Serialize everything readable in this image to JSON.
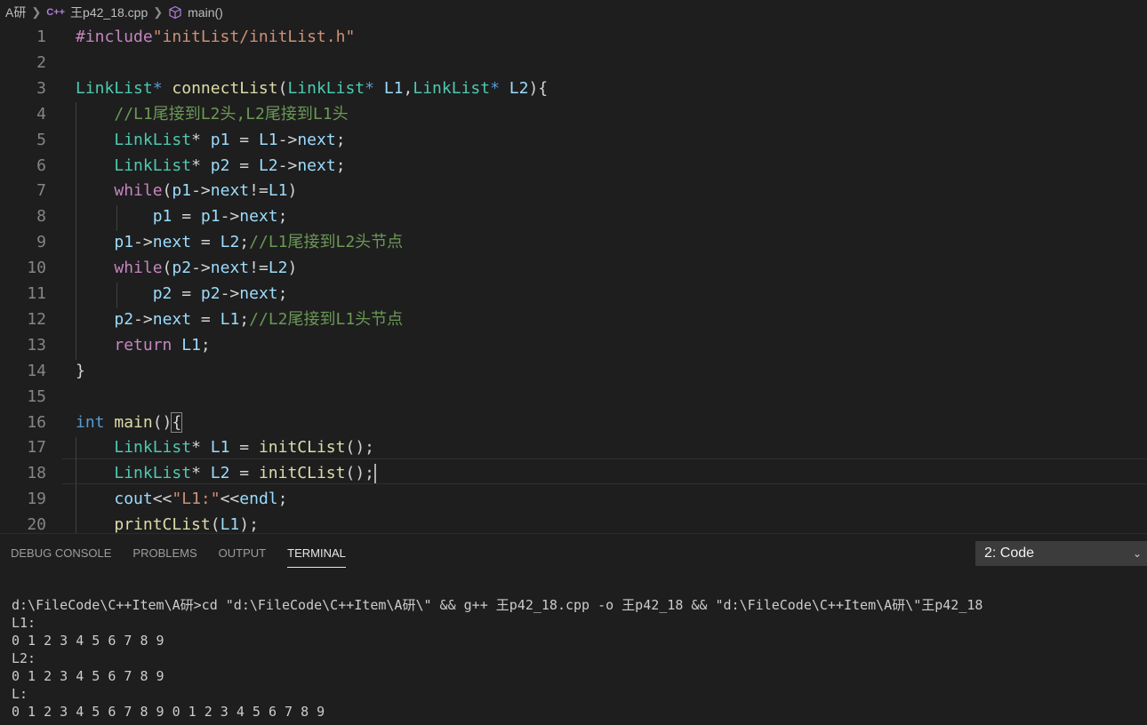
{
  "breadcrumb": {
    "folder": "A研",
    "file_icon": "C++",
    "file": "王p42_18.cpp",
    "symbol": "main()"
  },
  "editor": {
    "line_numbers": [
      "1",
      "2",
      "3",
      "4",
      "5",
      "6",
      "7",
      "8",
      "9",
      "10",
      "11",
      "12",
      "13",
      "14",
      "15",
      "16",
      "17",
      "18",
      "19",
      "20"
    ],
    "code_lines": [
      [
        {
          "t": "#include",
          "c": "pp"
        },
        {
          "t": "\"initList/initList.h\"",
          "c": "str"
        }
      ],
      [],
      [
        {
          "t": "LinkList",
          "c": "ty"
        },
        {
          "t": "* ",
          "c": "kwb"
        },
        {
          "t": "connectList",
          "c": "fn"
        },
        {
          "t": "(",
          "c": "op"
        },
        {
          "t": "LinkList",
          "c": "ty"
        },
        {
          "t": "* ",
          "c": "kwb"
        },
        {
          "t": "L1",
          "c": "var"
        },
        {
          "t": ",",
          "c": "op"
        },
        {
          "t": "LinkList",
          "c": "ty"
        },
        {
          "t": "* ",
          "c": "kwb"
        },
        {
          "t": "L2",
          "c": "var"
        },
        {
          "t": "){",
          "c": "op"
        }
      ],
      [
        {
          "t": "    ",
          "c": "op"
        },
        {
          "t": "//L1尾接到L2头,L2尾接到L1头",
          "c": "cm"
        }
      ],
      [
        {
          "t": "    ",
          "c": "op"
        },
        {
          "t": "LinkList",
          "c": "ty"
        },
        {
          "t": "* ",
          "c": "op"
        },
        {
          "t": "p1",
          "c": "var"
        },
        {
          "t": " = ",
          "c": "op"
        },
        {
          "t": "L1",
          "c": "var"
        },
        {
          "t": "->",
          "c": "op"
        },
        {
          "t": "next",
          "c": "var"
        },
        {
          "t": ";",
          "c": "op"
        }
      ],
      [
        {
          "t": "    ",
          "c": "op"
        },
        {
          "t": "LinkList",
          "c": "ty"
        },
        {
          "t": "* ",
          "c": "op"
        },
        {
          "t": "p2",
          "c": "var"
        },
        {
          "t": " = ",
          "c": "op"
        },
        {
          "t": "L2",
          "c": "var"
        },
        {
          "t": "->",
          "c": "op"
        },
        {
          "t": "next",
          "c": "var"
        },
        {
          "t": ";",
          "c": "op"
        }
      ],
      [
        {
          "t": "    ",
          "c": "op"
        },
        {
          "t": "while",
          "c": "kw"
        },
        {
          "t": "(",
          "c": "op"
        },
        {
          "t": "p1",
          "c": "var"
        },
        {
          "t": "->",
          "c": "op"
        },
        {
          "t": "next",
          "c": "var"
        },
        {
          "t": "!=",
          "c": "op"
        },
        {
          "t": "L1",
          "c": "var"
        },
        {
          "t": ")",
          "c": "op"
        }
      ],
      [
        {
          "t": "        ",
          "c": "op"
        },
        {
          "t": "p1",
          "c": "var"
        },
        {
          "t": " = ",
          "c": "op"
        },
        {
          "t": "p1",
          "c": "var"
        },
        {
          "t": "->",
          "c": "op"
        },
        {
          "t": "next",
          "c": "var"
        },
        {
          "t": ";",
          "c": "op"
        }
      ],
      [
        {
          "t": "    ",
          "c": "op"
        },
        {
          "t": "p1",
          "c": "var"
        },
        {
          "t": "->",
          "c": "op"
        },
        {
          "t": "next",
          "c": "var"
        },
        {
          "t": " = ",
          "c": "op"
        },
        {
          "t": "L2",
          "c": "var"
        },
        {
          "t": ";",
          "c": "op"
        },
        {
          "t": "//L1尾接到L2头节点",
          "c": "cm"
        }
      ],
      [
        {
          "t": "    ",
          "c": "op"
        },
        {
          "t": "while",
          "c": "kw"
        },
        {
          "t": "(",
          "c": "op"
        },
        {
          "t": "p2",
          "c": "var"
        },
        {
          "t": "->",
          "c": "op"
        },
        {
          "t": "next",
          "c": "var"
        },
        {
          "t": "!=",
          "c": "op"
        },
        {
          "t": "L2",
          "c": "var"
        },
        {
          "t": ")",
          "c": "op"
        }
      ],
      [
        {
          "t": "        ",
          "c": "op"
        },
        {
          "t": "p2",
          "c": "var"
        },
        {
          "t": " = ",
          "c": "op"
        },
        {
          "t": "p2",
          "c": "var"
        },
        {
          "t": "->",
          "c": "op"
        },
        {
          "t": "next",
          "c": "var"
        },
        {
          "t": ";",
          "c": "op"
        }
      ],
      [
        {
          "t": "    ",
          "c": "op"
        },
        {
          "t": "p2",
          "c": "var"
        },
        {
          "t": "->",
          "c": "op"
        },
        {
          "t": "next",
          "c": "var"
        },
        {
          "t": " = ",
          "c": "op"
        },
        {
          "t": "L1",
          "c": "var"
        },
        {
          "t": ";",
          "c": "op"
        },
        {
          "t": "//L2尾接到L1头节点",
          "c": "cm"
        }
      ],
      [
        {
          "t": "    ",
          "c": "op"
        },
        {
          "t": "return",
          "c": "kw"
        },
        {
          "t": " ",
          "c": "op"
        },
        {
          "t": "L1",
          "c": "var"
        },
        {
          "t": ";",
          "c": "op"
        }
      ],
      [
        {
          "t": "}",
          "c": "op"
        }
      ],
      [],
      [
        {
          "t": "int",
          "c": "kwb"
        },
        {
          "t": " ",
          "c": "op"
        },
        {
          "t": "main",
          "c": "fn"
        },
        {
          "t": "()",
          "c": "op"
        },
        {
          "t": "{",
          "c": "op bracket-hl"
        }
      ],
      [
        {
          "t": "    ",
          "c": "op"
        },
        {
          "t": "LinkList",
          "c": "ty"
        },
        {
          "t": "* ",
          "c": "op"
        },
        {
          "t": "L1",
          "c": "var"
        },
        {
          "t": " = ",
          "c": "op"
        },
        {
          "t": "initCList",
          "c": "fn"
        },
        {
          "t": "();",
          "c": "op"
        }
      ],
      [
        {
          "t": "    ",
          "c": "op"
        },
        {
          "t": "LinkList",
          "c": "ty"
        },
        {
          "t": "* ",
          "c": "op"
        },
        {
          "t": "L2",
          "c": "var"
        },
        {
          "t": " = ",
          "c": "op"
        },
        {
          "t": "initCList",
          "c": "fn"
        },
        {
          "t": "();",
          "c": "op"
        }
      ],
      [
        {
          "t": "    ",
          "c": "op"
        },
        {
          "t": "cout",
          "c": "var"
        },
        {
          "t": "<<",
          "c": "op"
        },
        {
          "t": "\"L1:\"",
          "c": "str"
        },
        {
          "t": "<<",
          "c": "op"
        },
        {
          "t": "endl",
          "c": "var"
        },
        {
          "t": ";",
          "c": "op"
        }
      ],
      [
        {
          "t": "    ",
          "c": "op"
        },
        {
          "t": "printCList",
          "c": "fn"
        },
        {
          "t": "(",
          "c": "op"
        },
        {
          "t": "L1",
          "c": "var"
        },
        {
          "t": ");",
          "c": "op"
        }
      ]
    ]
  },
  "panel": {
    "tabs": [
      "DEBUG CONSOLE",
      "PROBLEMS",
      "OUTPUT",
      "TERMINAL"
    ],
    "active_tab": "TERMINAL",
    "terminal_selector": "2: Code",
    "terminal_lines": [
      "d:\\FileCode\\C++Item\\A研>cd \"d:\\FileCode\\C++Item\\A研\\\" && g++ 王p42_18.cpp -o 王p42_18 && \"d:\\FileCode\\C++Item\\A研\\\"王p42_18",
      "L1:",
      "0 1 2 3 4 5 6 7 8 9",
      "L2:",
      "0 1 2 3 4 5 6 7 8 9",
      "L:",
      "0 1 2 3 4 5 6 7 8 9 0 1 2 3 4 5 6 7 8 9"
    ]
  },
  "colors": {
    "background": "#1e1e1e",
    "keyword": "#c586c0",
    "type": "#4ec9b0",
    "function": "#dcdcaa",
    "variable": "#9cdcfe",
    "string": "#ce9178",
    "comment": "#6a9955",
    "builtin": "#569cd6"
  }
}
